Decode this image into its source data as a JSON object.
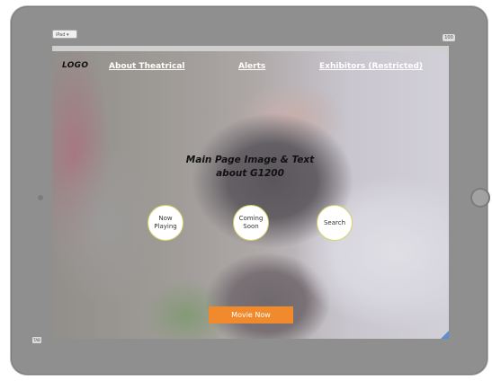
{
  "device": {
    "selector_label": "iPad",
    "zoom_badge": "100",
    "corner_badge": "TAB"
  },
  "nav": {
    "logo": "LOGO",
    "about": "About Theatrical",
    "alerts": "Alerts",
    "exhibitors": "Exhibitors (Restricted)"
  },
  "hero": {
    "text": "Main Page Image & Text about G1200"
  },
  "buttons": {
    "now_playing": "Now Playing",
    "coming_soon": "Coming Soon",
    "search": "Search",
    "movie_now": "Movie Now"
  },
  "colors": {
    "accent_orange": "#f08a2c",
    "circle_border": "#d8d26a",
    "frame_gray": "#8f8f8f",
    "resize_handle_blue": "#5b8fd0"
  },
  "icons": {
    "home_button": "home-button-icon",
    "resize": "resize-handle-icon"
  }
}
